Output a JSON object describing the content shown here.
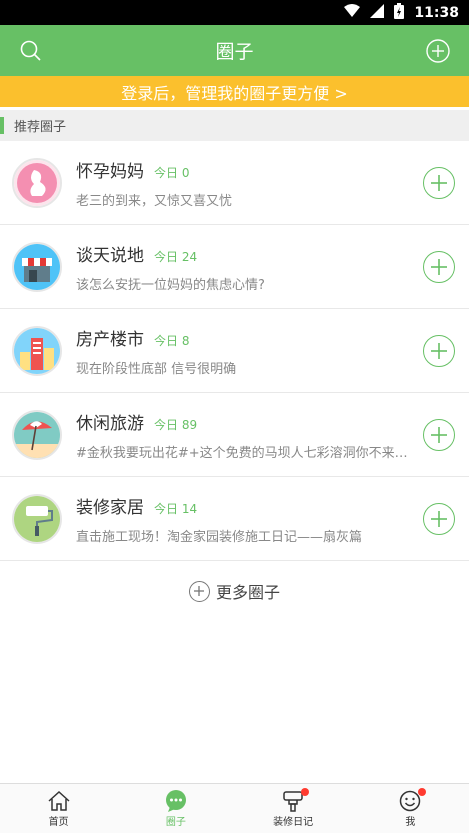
{
  "status_bar": {
    "time": "11:38"
  },
  "app_bar": {
    "title": "圈子"
  },
  "login_banner": "登录后，管理我的圈子更方便 >",
  "section": {
    "title": "推荐圈子"
  },
  "circles": [
    {
      "name": "怀孕妈妈",
      "today": "今日 0",
      "desc": "老三的到来，又惊又喜又忧",
      "avatar": "pregnant-mother-avatar",
      "color": "#f48fb1"
    },
    {
      "name": "谈天说地",
      "today": "今日 24",
      "desc": "该怎么安抚一位妈妈的焦虑心情?",
      "avatar": "storefront-avatar",
      "color": "#4fc3f7"
    },
    {
      "name": "房产楼市",
      "today": "今日 8",
      "desc": "现在阶段性底部 信号很明确",
      "avatar": "buildings-avatar",
      "color": "#81d4fa"
    },
    {
      "name": "休闲旅游",
      "today": "今日 89",
      "desc": "#金秋我要玩出花#+这个免费的马坝人七彩溶洞你不来…",
      "avatar": "beach-umbrella-avatar",
      "color": "#80cbc4"
    },
    {
      "name": "装修家居",
      "today": "今日 14",
      "desc": "直击施工现场！淘金家园装修施工日记——扇灰篇",
      "avatar": "paint-roller-avatar",
      "color": "#aed581"
    }
  ],
  "more_label": "更多圈子",
  "tabs": [
    {
      "label": "首页",
      "icon": "home-icon"
    },
    {
      "label": "圈子",
      "icon": "chat-bubble-icon"
    },
    {
      "label": "装修日记",
      "icon": "paint-brush-icon"
    },
    {
      "label": "我",
      "icon": "smiley-face-icon"
    }
  ],
  "colors": {
    "brand": "#67c065",
    "banner": "#fbc02d",
    "badge": "#ff3b30"
  }
}
